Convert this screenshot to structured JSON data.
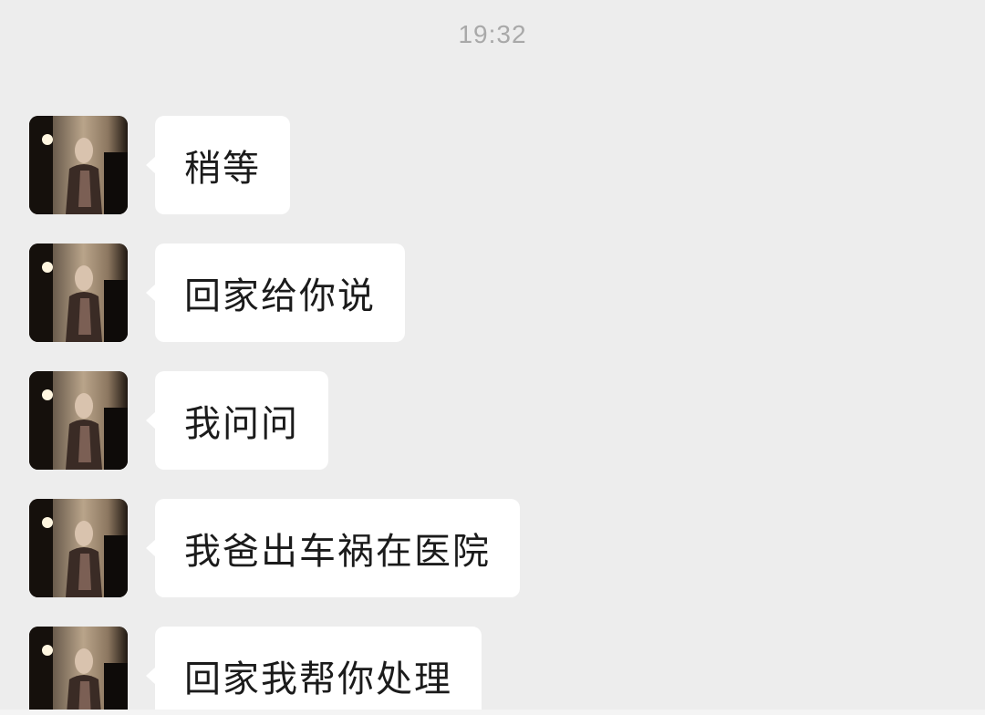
{
  "timestamp": "19:32",
  "messages": [
    {
      "text": "稍等"
    },
    {
      "text": "回家给你说"
    },
    {
      "text": "我问问"
    },
    {
      "text": "我爸出车祸在医院"
    },
    {
      "text": "回家我帮你处理"
    }
  ],
  "colors": {
    "background": "#ededed",
    "bubble": "#ffffff",
    "timestamp_text": "#a9a9a9",
    "message_text": "#1b1b1b"
  }
}
